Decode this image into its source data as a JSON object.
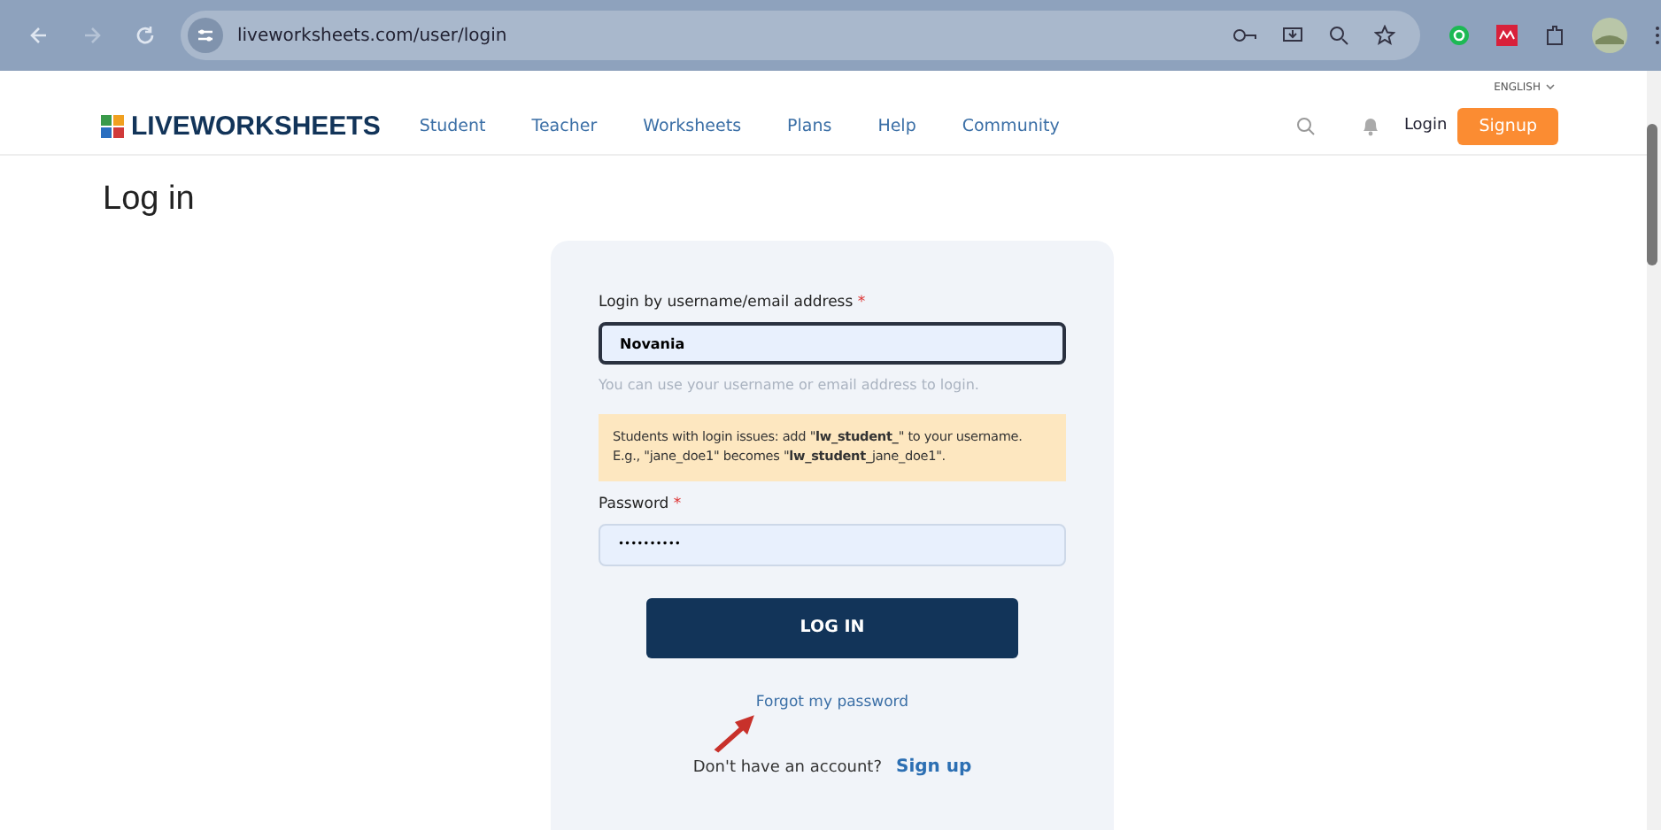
{
  "browser": {
    "url": "liveworksheets.com/user/login"
  },
  "language": "ENGLISH",
  "nav": {
    "logo": "LIVEWORKSHEETS",
    "links": [
      "Student",
      "Teacher",
      "Worksheets",
      "Plans",
      "Help",
      "Community"
    ],
    "login": "Login",
    "signup": "Signup"
  },
  "page_title": "Log in",
  "form": {
    "username_label": "Login by username/email address",
    "required_mark": "*",
    "username_value": "Novania",
    "username_hint": "You can use your username or email address to login.",
    "notice": "Students with login issues: add \"**lw_student_**\" to your username. E.g., \"jane_doe1\" becomes \"**lw_student_**jane_doe1\".",
    "password_label": "Password",
    "password_value": "••••••••••",
    "submit": "LOG IN",
    "forgot": "Forgot my password",
    "no_account": "Don't have an account?",
    "signup_link": "Sign up"
  }
}
